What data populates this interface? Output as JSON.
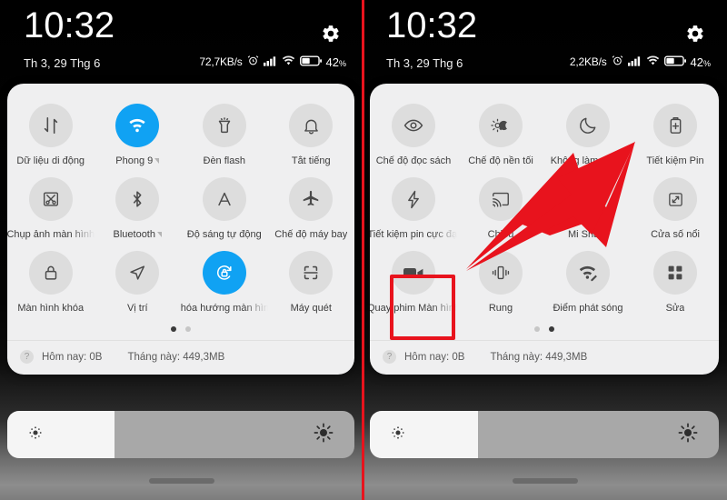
{
  "meta": {
    "accent_blue": "#10a2f3",
    "annotation_red": "#e8131d",
    "panel_bg": "#efeff0"
  },
  "left_phone": {
    "status": {
      "clock": "10:32",
      "date": "Th 3, 29 Thg 6",
      "net_speed": "72,7KB/s",
      "battery_percent": "42",
      "percent_symbol": "%",
      "gear_icon": "gear-icon",
      "alarm_icon": "alarm-icon",
      "signal_icon": "signal-icon",
      "wifi_icon": "wifi-icon",
      "battery_icon": "battery-icon"
    },
    "tiles": [
      [
        {
          "label": "Dữ liệu di động",
          "icon": "mobile-data-icon",
          "active": false,
          "truncated": false,
          "caret": false
        },
        {
          "label": "Phong 9",
          "icon": "wifi-icon",
          "active": true,
          "truncated": false,
          "caret": true
        },
        {
          "label": "Đèn flash",
          "icon": "flashlight-icon",
          "active": false,
          "truncated": false,
          "caret": false
        },
        {
          "label": "Tắt tiếng",
          "icon": "bell-mute-icon",
          "active": false,
          "truncated": false,
          "caret": false
        }
      ],
      [
        {
          "label": "Chụp ảnh màn hình",
          "icon": "screenshot-icon",
          "active": false,
          "truncated": true,
          "caret": false
        },
        {
          "label": "Bluetooth",
          "icon": "bluetooth-icon",
          "active": false,
          "truncated": false,
          "caret": true
        },
        {
          "label": "Độ sáng tự động",
          "icon": "auto-brightness-icon",
          "active": false,
          "truncated": false,
          "caret": false
        },
        {
          "label": "Chế độ máy bay",
          "icon": "airplane-icon",
          "active": false,
          "truncated": false,
          "caret": false
        }
      ],
      [
        {
          "label": "Màn hình khóa",
          "icon": "lock-icon",
          "active": false,
          "truncated": false,
          "caret": false
        },
        {
          "label": "Vị trí",
          "icon": "location-icon",
          "active": false,
          "truncated": false,
          "caret": false
        },
        {
          "label": "Khóa hướng màn hình",
          "icon": "rotation-lock-icon",
          "active": true,
          "truncated": true,
          "caret": false
        },
        {
          "label": "Máy quét",
          "icon": "scanner-icon",
          "active": false,
          "truncated": false,
          "caret": false
        }
      ]
    ],
    "pager": {
      "count": 2,
      "active_index": 0
    },
    "usage": {
      "help_icon": "help-icon",
      "today": "Hôm nay: 0B",
      "month": "Tháng này: 449,3MB"
    },
    "brightness": {
      "value_percent": 31,
      "low_icon": "brightness-low-icon",
      "high_icon": "brightness-high-icon"
    }
  },
  "right_phone": {
    "status": {
      "clock": "10:32",
      "date": "Th 3, 29 Thg 6",
      "net_speed": "2,2KB/s",
      "battery_percent": "42",
      "percent_symbol": "%",
      "gear_icon": "gear-icon",
      "alarm_icon": "alarm-icon",
      "signal_icon": "signal-icon",
      "wifi_icon": "wifi-icon",
      "battery_icon": "battery-icon"
    },
    "tiles": [
      [
        {
          "label": "Chế độ đọc sách",
          "icon": "reading-mode-icon",
          "active": false,
          "truncated": false,
          "caret": false
        },
        {
          "label": "Chế độ nền tối",
          "icon": "dark-mode-icon",
          "active": false,
          "truncated": false,
          "caret": false
        },
        {
          "label": "Không làm phiền",
          "icon": "do-not-disturb-icon",
          "active": false,
          "truncated": true,
          "caret": false
        },
        {
          "label": "Tiết kiệm Pin",
          "icon": "battery-saver-icon",
          "active": false,
          "truncated": false,
          "caret": false
        }
      ],
      [
        {
          "label": "Tiết kiệm pin cực đại",
          "icon": "ultra-battery-saver-icon",
          "active": false,
          "truncated": true,
          "caret": false
        },
        {
          "label": "Chiếu",
          "icon": "cast-icon",
          "active": false,
          "truncated": false,
          "caret": false
        },
        {
          "label": "Mi Share",
          "icon": "mi-share-icon",
          "active": false,
          "truncated": false,
          "caret": false
        },
        {
          "label": "Cửa số nổi",
          "icon": "floating-window-icon",
          "active": false,
          "truncated": false,
          "caret": false
        }
      ],
      [
        {
          "label": "Quay phim Màn hình",
          "icon": "screen-record-icon",
          "active": false,
          "truncated": true,
          "caret": false,
          "highlighted": true
        },
        {
          "label": "Rung",
          "icon": "vibrate-icon",
          "active": false,
          "truncated": false,
          "caret": false
        },
        {
          "label": "Điểm phát sóng",
          "icon": "hotspot-icon",
          "active": false,
          "truncated": false,
          "caret": false
        },
        {
          "label": "Sửa",
          "icon": "edit-grid-icon",
          "active": false,
          "truncated": false,
          "caret": false
        }
      ]
    ],
    "pager": {
      "count": 2,
      "active_index": 1
    },
    "usage": {
      "help_icon": "help-icon",
      "today": "Hôm nay: 0B",
      "month": "Tháng này: 449,3MB"
    },
    "brightness": {
      "value_percent": 31,
      "low_icon": "brightness-low-icon",
      "high_icon": "brightness-high-icon"
    },
    "annotations": {
      "arrow_icon": "red-arrow-pointer",
      "highlight_icon": "red-highlight-box"
    }
  }
}
